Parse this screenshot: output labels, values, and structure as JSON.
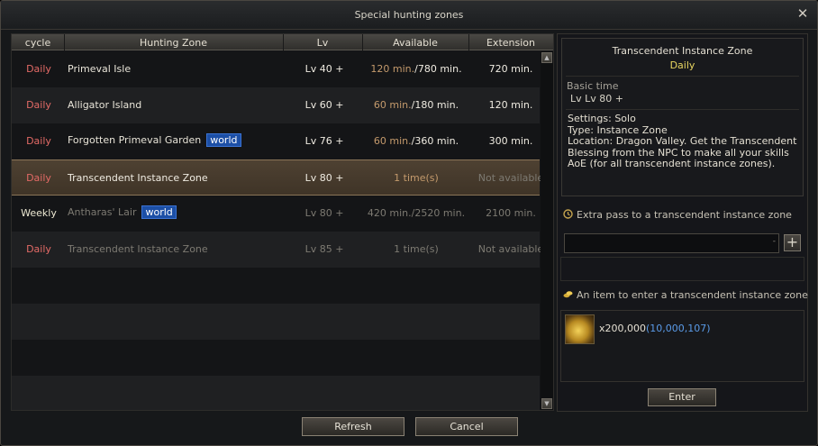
{
  "window": {
    "title": "Special hunting zones"
  },
  "table": {
    "headers": {
      "cycle": "cycle",
      "zone": "Hunting Zone",
      "lv": "Lv",
      "available": "Available",
      "extension": "Extension"
    },
    "rows": [
      {
        "cycle": "Daily",
        "zone": "Primeval Isle",
        "world": "",
        "lv": "Lv 40 +",
        "avail_a": "120 min.",
        "avail_b": "/780 min.",
        "extension": "720 min."
      },
      {
        "cycle": "Daily",
        "zone": "Alligator Island",
        "world": "",
        "lv": "Lv 60 +",
        "avail_a": "60 min.",
        "avail_b": "/180 min.",
        "extension": "120 min."
      },
      {
        "cycle": "Daily",
        "zone": "Forgotten Primeval Garden",
        "world": "world",
        "lv": "Lv 76 +",
        "avail_a": "60 min.",
        "avail_b": "/360 min.",
        "extension": "300 min."
      },
      {
        "cycle": "Daily",
        "zone": "Transcendent Instance Zone",
        "world": "",
        "lv": "Lv 80 +",
        "avail_a": "1  time(s)",
        "avail_b": "",
        "extension": "Not available"
      },
      {
        "cycle": "Weekly",
        "zone": "Antharas' Lair",
        "world": "world",
        "lv": "Lv 80 +",
        "avail_a": "420 min./2520 min.",
        "avail_b": "",
        "extension": "2100 min."
      },
      {
        "cycle": "Daily",
        "zone": "Transcendent Instance Zone",
        "world": "",
        "lv": "Lv 85 +",
        "avail_a": "1  time(s)",
        "avail_b": "",
        "extension": "Not available"
      }
    ]
  },
  "info": {
    "zone_name": "Transcendent Instance Zone",
    "cycle": "Daily",
    "basic_time_label": "Basic time",
    "basic_time_value": "Lv Lv 80 +",
    "settings": "Settings: Solo\nType: Instance Zone\nLocation: Dragon Valley. Get the Transcendent Blessing from the NPC to make all your skills AoE (for all transcendent instance zones).",
    "extra_pass_title": "Extra pass to a transcendent instance zone",
    "entry_item_title": "An item to enter a transcendent instance zone",
    "item_count": "x200,000",
    "item_owned": "(10,000,107)",
    "enter_label": "Enter"
  },
  "buttons": {
    "refresh": "Refresh",
    "cancel": "Cancel"
  },
  "icons": {
    "close": "close-icon",
    "scroll_up": "arrow-up-icon",
    "scroll_down": "arrow-down-icon",
    "pass": "clock-icon",
    "item": "coins-icon",
    "add": "plus-icon"
  },
  "colors": {
    "daily": "#e36a66",
    "weekly": "#ece8d2",
    "cycle_highlight": "#e8d560",
    "world_tag": "#1c4fa6",
    "owned_count": "#5a9be8"
  }
}
